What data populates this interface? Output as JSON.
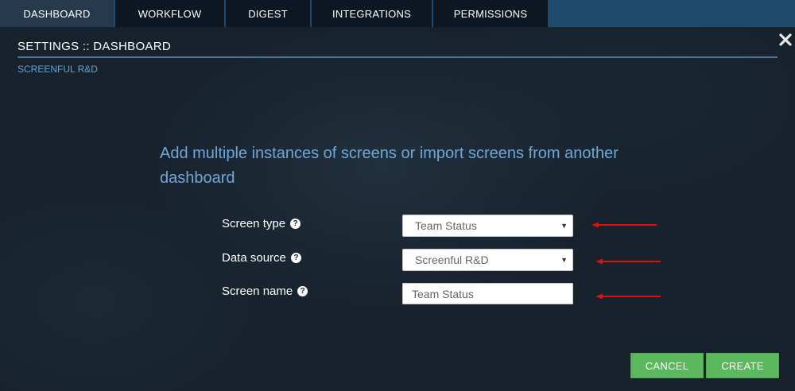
{
  "tabs": [
    {
      "label": "DASHBOARD",
      "active": true
    },
    {
      "label": "WORKFLOW",
      "active": false
    },
    {
      "label": "DIGEST",
      "active": false
    },
    {
      "label": "INTEGRATIONS",
      "active": false
    },
    {
      "label": "PERMISSIONS",
      "active": false
    }
  ],
  "header": {
    "title": "SETTINGS :: DASHBOARD",
    "breadcrumb": "SCREENFUL R&D",
    "close_icon": "close-icon"
  },
  "intro_text": "Add multiple instances of screens or import screens from another dashboard",
  "form": {
    "screen_type": {
      "label": "Screen type",
      "value": "Team Status",
      "help_icon": "question-circle-icon"
    },
    "data_source": {
      "label": "Data source",
      "value": "Screenful R&D",
      "help_icon": "question-circle-icon"
    },
    "screen_name": {
      "label": "Screen name",
      "value": "Team Status",
      "help_icon": "question-circle-icon"
    }
  },
  "buttons": {
    "cancel": "CANCEL",
    "create": "CREATE"
  },
  "colors": {
    "tab_bar": "#1e4a6e",
    "tab": "#0d1721",
    "tab_active": "#253a4c",
    "accent_blue": "#6fa8d8",
    "button_green": "#5cb85c",
    "annotation_red": "#e01010",
    "background": "#17222c"
  }
}
